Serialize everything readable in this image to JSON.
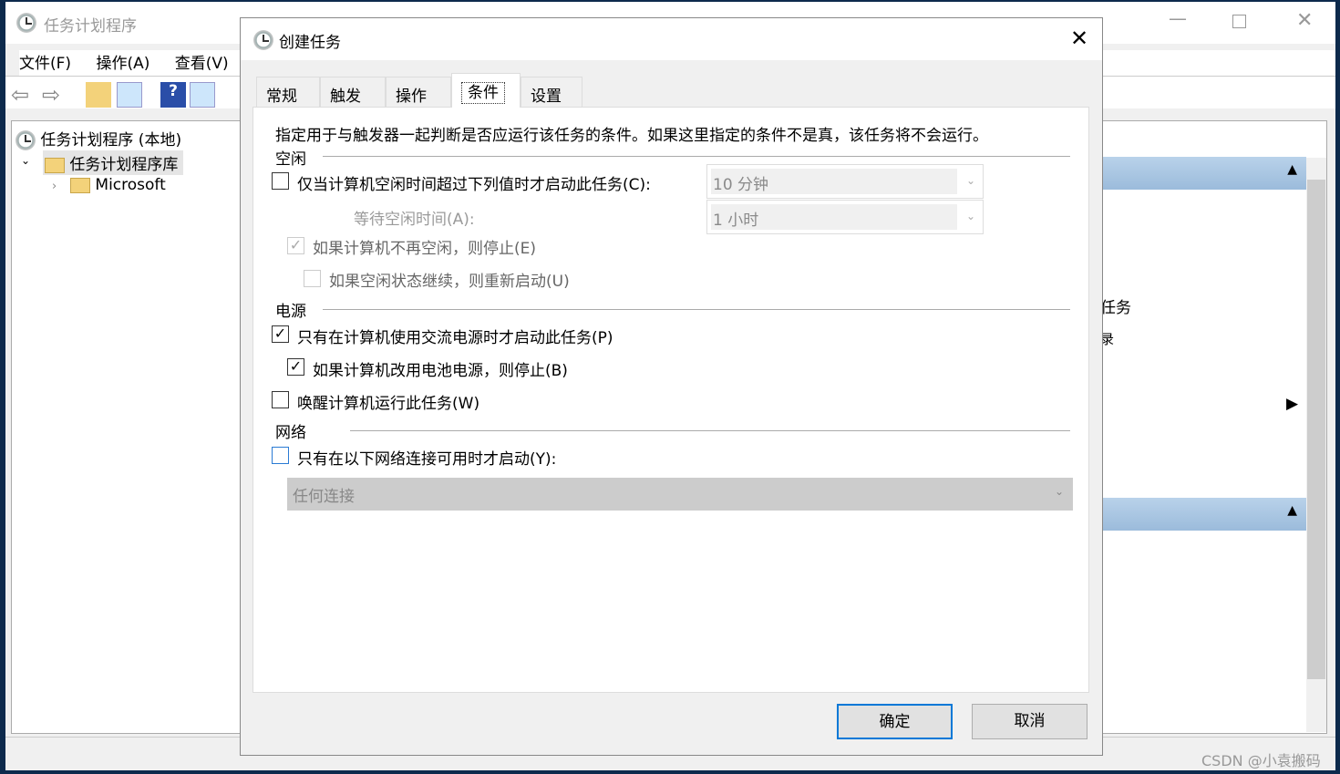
{
  "main": {
    "title": "任务计划程序",
    "menu": [
      "文件(F)",
      "操作(A)",
      "查看(V)"
    ],
    "tree": [
      "任务计划程序 (本地)",
      "任务计划程序库",
      "Microsoft"
    ],
    "right_fragments": [
      "任务",
      "录"
    ]
  },
  "dialog": {
    "title": "创建任务",
    "tabs": [
      "常规",
      "触发器",
      "操作",
      "条件",
      "设置"
    ],
    "active_tab": "条件",
    "description": "指定用于与触发器一起判断是否应运行该任务的条件。如果这里指定的条件不是真，该任务将不会运行。",
    "idle": {
      "header": "空闲",
      "start_if_idle": {
        "label": "仅当计算机空闲时间超过下列值时才启动此任务(C):",
        "checked": false
      },
      "idle_duration": "10 分钟",
      "wait_label": "等待空闲时间(A):",
      "wait_value": "1 小时",
      "stop_if_not_idle": {
        "label": "如果计算机不再空闲，则停止(E)",
        "checked": true,
        "disabled": true
      },
      "restart_if_idle": {
        "label": "如果空闲状态继续，则重新启动(U)",
        "checked": false,
        "disabled": true
      }
    },
    "power": {
      "header": "电源",
      "ac_only": {
        "label": "只有在计算机使用交流电源时才启动此任务(P)",
        "checked": true
      },
      "stop_on_battery": {
        "label": "如果计算机改用电池电源，则停止(B)",
        "checked": true
      },
      "wake": {
        "label": "唤醒计算机运行此任务(W)",
        "checked": false
      }
    },
    "network": {
      "header": "网络",
      "only_if_network": {
        "label": "只有在以下网络连接可用时才启动(Y):",
        "checked": false
      },
      "connection": "任何连接"
    },
    "ok": "确定",
    "cancel": "取消"
  },
  "watermark": "CSDN @小袁搬码"
}
